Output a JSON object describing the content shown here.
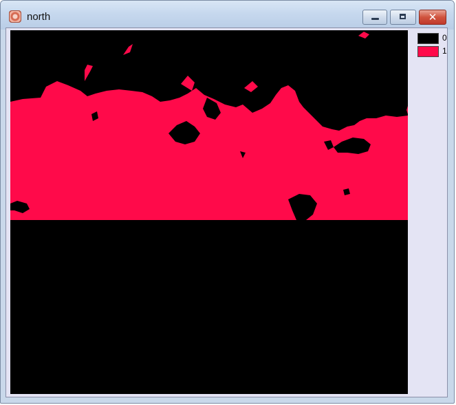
{
  "window": {
    "title": "north",
    "app_icon": "raster-layer-icon",
    "controls": {
      "minimize_icon": "minimize-icon",
      "maximize_icon": "restore-icon",
      "close_icon": "close-icon",
      "close_glyph": "✕"
    }
  },
  "raster": {
    "name": "north",
    "colors": {
      "class_0": "#000000",
      "class_1": "#ff0a4a"
    }
  },
  "legend": [
    {
      "value": "0",
      "color": "#000000"
    },
    {
      "value": "1",
      "color": "#ff0a4a"
    }
  ]
}
